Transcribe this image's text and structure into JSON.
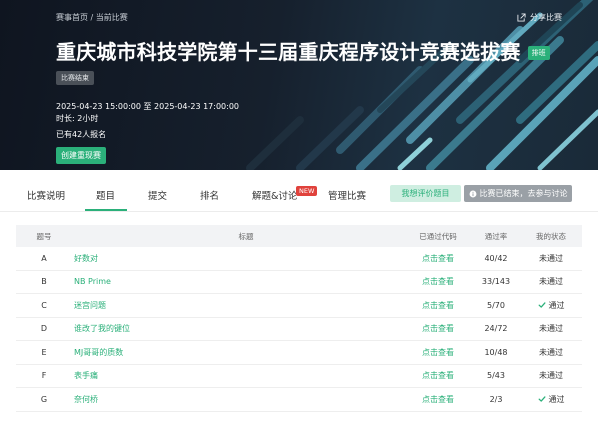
{
  "header": {
    "breadcrumb_home": "赛事首页",
    "breadcrumb_sep": "/",
    "breadcrumb_current": "当前比赛",
    "share_label": "分享比赛",
    "title": "重庆城市科技学院第十三届重庆程序设计竞赛选拔赛",
    "title_tag": "排班",
    "status_tag": "比赛结束",
    "time": "2025-04-23 15:00:00 至 2025-04-23 17:00:00",
    "duration": "时长: 2小时",
    "registered": "已有42人报名",
    "replay_button": "创建重现赛"
  },
  "tabs": {
    "items": [
      "比赛说明",
      "题目",
      "提交",
      "排名",
      "解题&讨论",
      "管理比赛"
    ],
    "active": "题目",
    "new_badge": "NEW",
    "review_button": "我想评价题目",
    "ended_button": "比赛已结束，去参与讨论"
  },
  "table": {
    "headers": {
      "num": "题号",
      "title": "标题",
      "code": "已通过代码",
      "rate": "通过率",
      "state": "我的状态"
    },
    "rows": [
      {
        "num": "A",
        "title": "好数对",
        "code": "点击查看",
        "rate": "40/42",
        "state": "未通过",
        "passed": false
      },
      {
        "num": "B",
        "title": "NB Prime",
        "code": "点击查看",
        "rate": "33/143",
        "state": "未通过",
        "passed": false
      },
      {
        "num": "C",
        "title": "迷宫问题",
        "code": "点击查看",
        "rate": "5/70",
        "state": "通过",
        "passed": true
      },
      {
        "num": "D",
        "title": "谁改了我的键位",
        "code": "点击查看",
        "rate": "24/72",
        "state": "未通过",
        "passed": false
      },
      {
        "num": "E",
        "title": "MJ哥哥的质数",
        "code": "点击查看",
        "rate": "10/48",
        "state": "未通过",
        "passed": false
      },
      {
        "num": "F",
        "title": "表手痛",
        "code": "点击查看",
        "rate": "5/43",
        "state": "未通过",
        "passed": false
      },
      {
        "num": "G",
        "title": "奈何桥",
        "code": "点击查看",
        "rate": "2/3",
        "state": "通过",
        "passed": true
      }
    ]
  },
  "colors": {
    "accent": "#2bb07a",
    "badge_new": "#e0423c",
    "banner_dark": "#0f1520"
  },
  "icons": {
    "share": "share-icon",
    "ended": "info-circle-icon",
    "passed": "check-icon"
  }
}
